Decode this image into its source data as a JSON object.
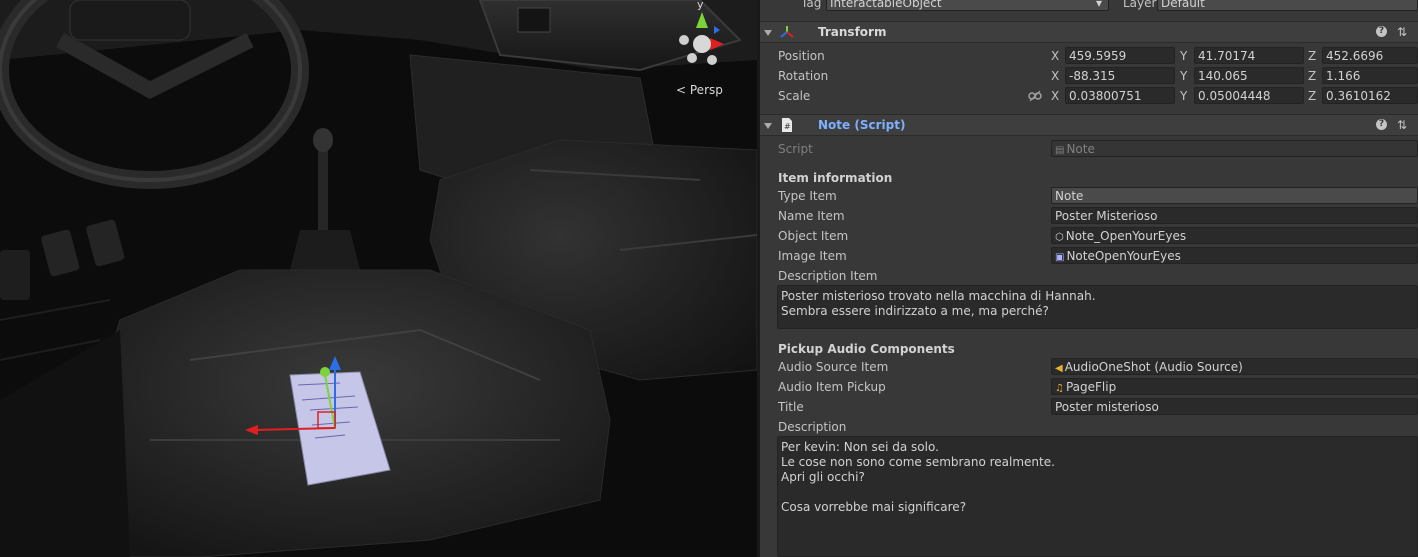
{
  "scene": {
    "persp_label": "Persp",
    "axis_y_label": "y"
  },
  "header": {
    "tag_label": "Tag",
    "tag_value": "InteractableObject",
    "layer_label": "Layer",
    "layer_value": "Default"
  },
  "transform": {
    "title": "Transform",
    "position": {
      "label": "Position",
      "x": "459.5959",
      "y": "41.70174",
      "z": "452.6696"
    },
    "rotation": {
      "label": "Rotation",
      "x": "-88.315",
      "y": "140.065",
      "z": "1.166"
    },
    "scale": {
      "label": "Scale",
      "x": "0.03800751",
      "y": "0.05004448",
      "z": "0.3610162"
    },
    "axis_x": "X",
    "axis_y": "Y",
    "axis_z": "Z"
  },
  "note_script": {
    "title": "Note (Script)",
    "script_label": "Script",
    "script_value": "Note",
    "item_info_header": "Item information",
    "type_item_label": "Type Item",
    "type_item_value": "Note",
    "name_item_label": "Name Item",
    "name_item_value": "Poster Misterioso",
    "object_item_label": "Object Item",
    "object_item_value": "Note_OpenYourEyes",
    "image_item_label": "Image Item",
    "image_item_value": "NoteOpenYourEyes",
    "description_item_label": "Description Item",
    "description_item_value": "Poster misterioso trovato nella macchina di Hannah.\nSembra essere indirizzato a me, ma perché?",
    "pickup_audio_header": "Pickup Audio Components",
    "audio_source_label": "Audio Source Item",
    "audio_source_value": "AudioOneShot (Audio Source)",
    "audio_pickup_label": "Audio Item Pickup",
    "audio_pickup_value": "PageFlip",
    "title_label": "Title",
    "title_value": "Poster misterioso",
    "description_label": "Description",
    "description_value": "Per kevin: Non sei da solo.\nLe cose non sono come sembrano realmente.\nApri gli occhi?\n\nCosa vorrebbe mai significare?"
  },
  "colors": {
    "inspector_bg": "#383838",
    "field_bg": "#2a2a2a",
    "link_blue": "#7fb0ff",
    "axis_red": "#e02020",
    "axis_green": "#7ad43a",
    "axis_blue": "#2a6ee8"
  }
}
